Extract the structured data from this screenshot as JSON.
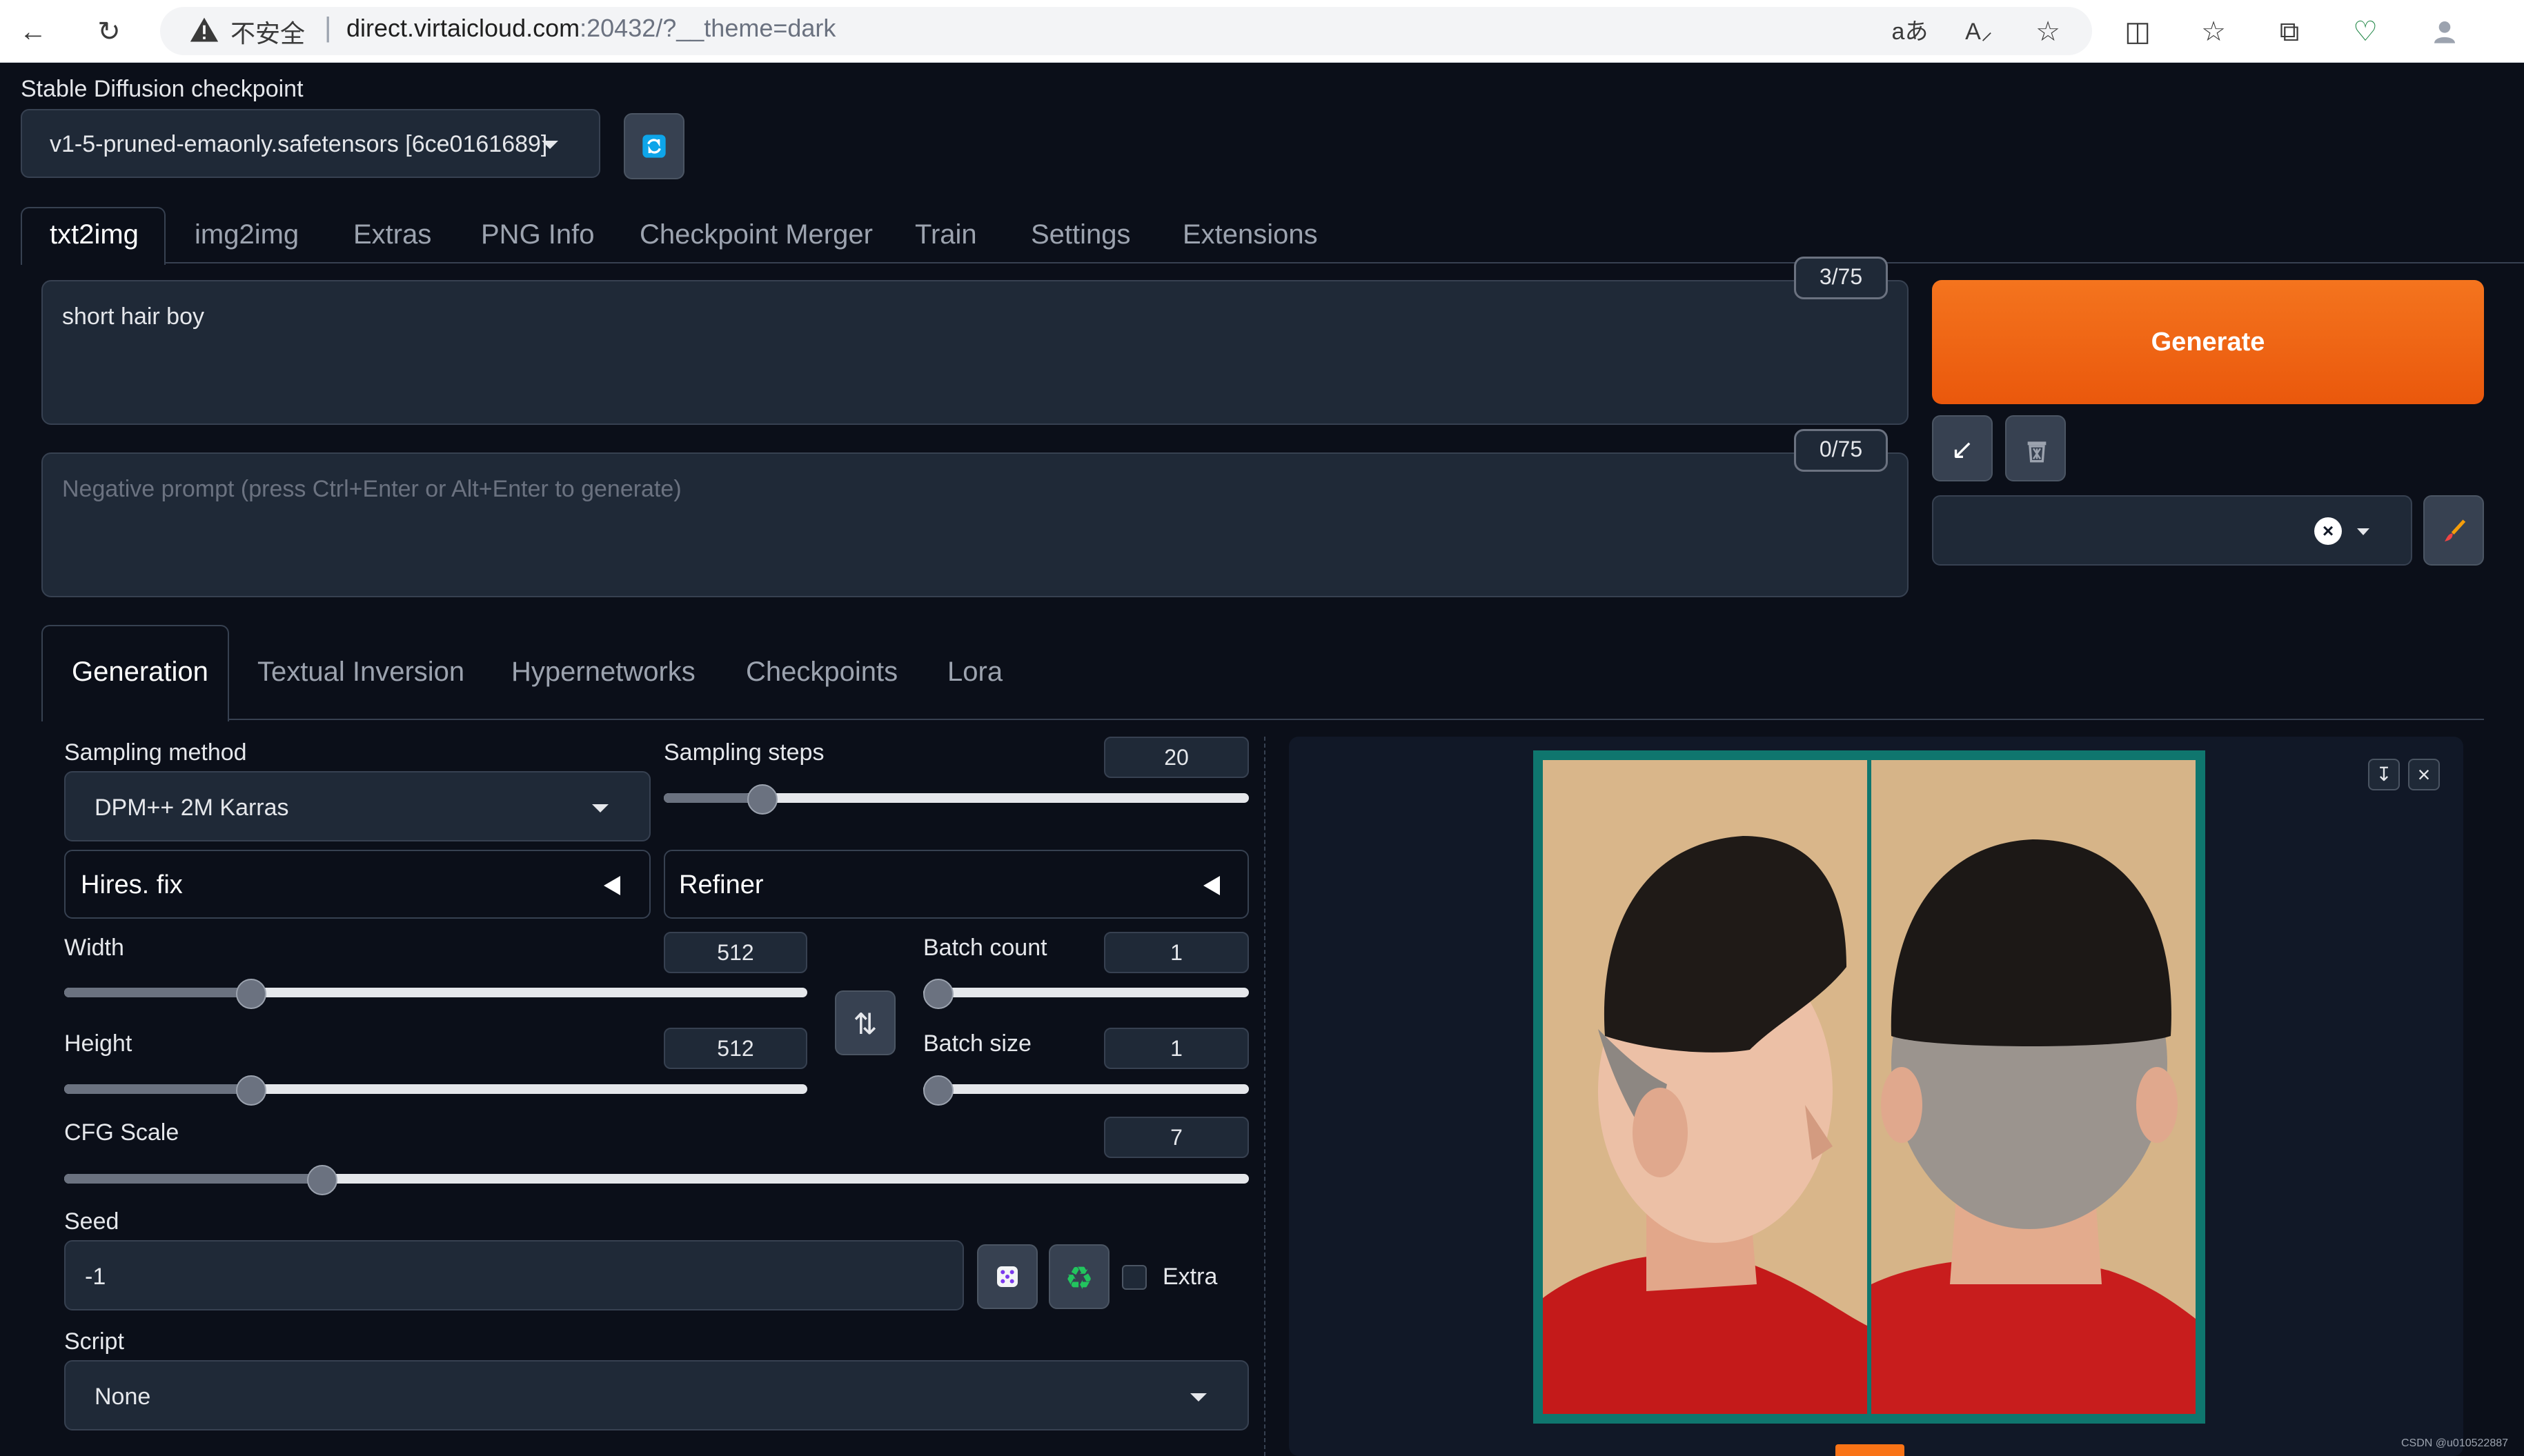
{
  "browser": {
    "insecure_label": "不安全",
    "url_host": "direct.virtaicloud.com",
    "url_rest": ":20432/?__theme=dark"
  },
  "checkpoint": {
    "label": "Stable Diffusion checkpoint",
    "value": "v1-5-pruned-emaonly.safetensors [6ce0161689]"
  },
  "main_tabs": [
    "txt2img",
    "img2img",
    "Extras",
    "PNG Info",
    "Checkpoint Merger",
    "Train",
    "Settings",
    "Extensions"
  ],
  "prompt": {
    "value": "short hair boy",
    "counter": "3/75"
  },
  "negative_prompt": {
    "placeholder": "Negative prompt (press Ctrl+Enter or Alt+Enter to generate)",
    "counter": "0/75"
  },
  "generate_label": "Generate",
  "sub_tabs": [
    "Generation",
    "Textual Inversion",
    "Hypernetworks",
    "Checkpoints",
    "Lora"
  ],
  "sampling_method": {
    "label": "Sampling method",
    "value": "DPM++ 2M Karras"
  },
  "sampling_steps": {
    "label": "Sampling steps",
    "value": "20",
    "fraction": 0.15
  },
  "hires_fix_label": "Hires. fix",
  "refiner_label": "Refiner",
  "width": {
    "label": "Width",
    "value": "512",
    "fraction": 0.24
  },
  "height": {
    "label": "Height",
    "value": "512",
    "fraction": 0.24
  },
  "batch_count": {
    "label": "Batch count",
    "value": "1",
    "fraction": 0.0
  },
  "batch_size": {
    "label": "Batch size",
    "value": "1",
    "fraction": 0.0
  },
  "cfg_scale": {
    "label": "CFG Scale",
    "value": "7",
    "fraction": 0.21
  },
  "seed": {
    "label": "Seed",
    "value": "-1"
  },
  "extra_label": "Extra",
  "script": {
    "label": "Script",
    "value": "None"
  },
  "watermark": "CSDN @u010522887",
  "colors": {
    "generate_orange": "#f26d1b",
    "background": "#0b0f19",
    "panel": "#1f2937"
  }
}
